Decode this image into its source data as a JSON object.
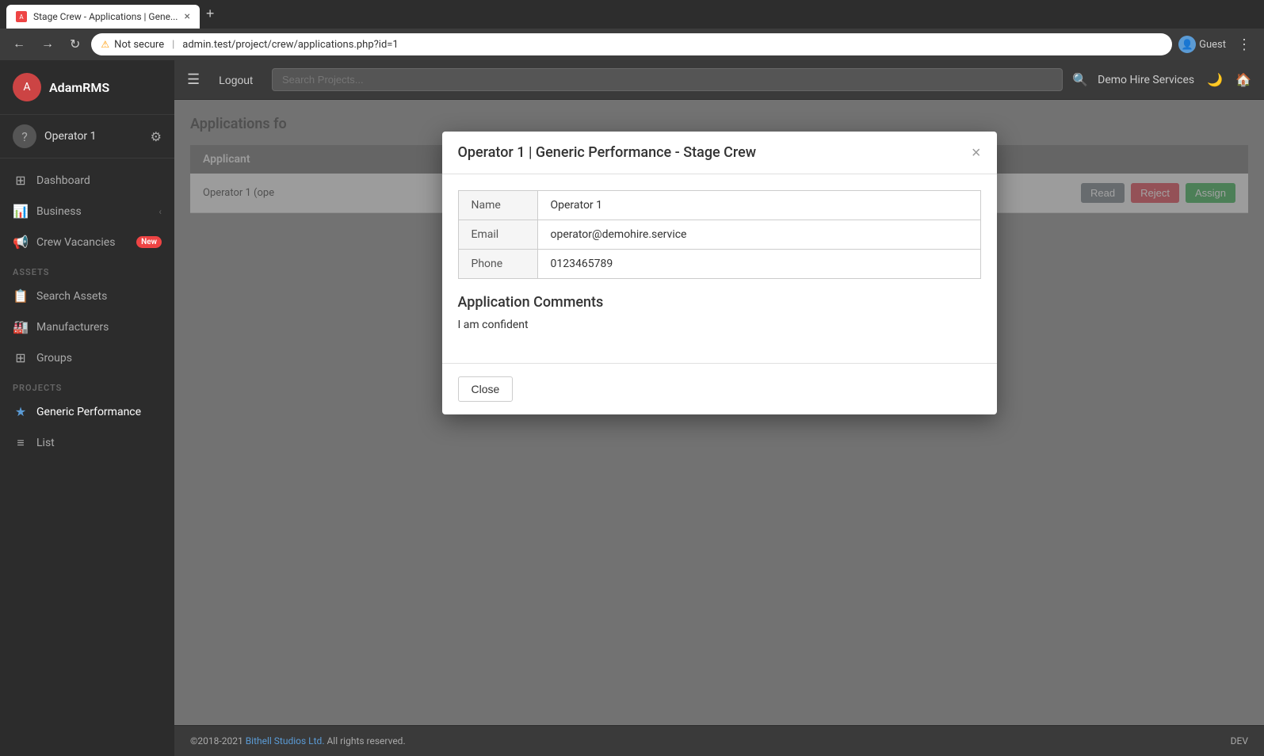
{
  "browser": {
    "tab_title": "Stage Crew - Applications | Gene...",
    "tab_favicon": "A",
    "url": "admin.test/project/crew/applications.php?id=1",
    "security_warning": "Not secure",
    "profile_label": "Guest"
  },
  "topbar": {
    "logout_label": "Logout",
    "search_placeholder": "Search Projects...",
    "service_name": "Demo Hire Services"
  },
  "sidebar": {
    "app_name": "AdamRMS",
    "username": "Operator 1",
    "nav_items": [
      {
        "id": "dashboard",
        "label": "Dashboard",
        "icon": "⊞"
      },
      {
        "id": "business",
        "label": "Business",
        "icon": "📊",
        "has_arrow": true
      }
    ],
    "section_assets": "ASSETS",
    "assets_items": [
      {
        "id": "search-assets",
        "label": "Search Assets",
        "icon": "📋"
      },
      {
        "id": "manufacturers",
        "label": "Manufacturers",
        "icon": "🏭"
      },
      {
        "id": "groups",
        "label": "Groups",
        "icon": "⊞"
      }
    ],
    "section_projects": "PROJECTS",
    "projects_items": [
      {
        "id": "generic-performance",
        "label": "Generic Performance",
        "icon": "★"
      },
      {
        "id": "list",
        "label": "List",
        "icon": "≡"
      }
    ],
    "crew_vacancies_label": "Crew Vacancies",
    "crew_vacancies_badge": "New"
  },
  "main": {
    "page_title": "Applications fo",
    "table_header": "Applicant",
    "table_row_text": "Operator 1 (ope",
    "btn_read": "Read",
    "btn_reject": "Reject",
    "btn_assign": "Assign"
  },
  "modal": {
    "title": "Operator 1 | Generic Performance - Stage Crew",
    "close_icon": "×",
    "fields": [
      {
        "label": "Name",
        "value": "Operator 1"
      },
      {
        "label": "Email",
        "value": "operator@demohire.service"
      },
      {
        "label": "Phone",
        "value": "0123465789"
      }
    ],
    "comments_title": "Application Comments",
    "comment_text": "I am confident",
    "close_button": "Close"
  },
  "footer": {
    "copyright": "©2018-2021",
    "company_name": "Bithell Studios Ltd.",
    "rights": " All rights reserved.",
    "dev_label": "DEV"
  }
}
